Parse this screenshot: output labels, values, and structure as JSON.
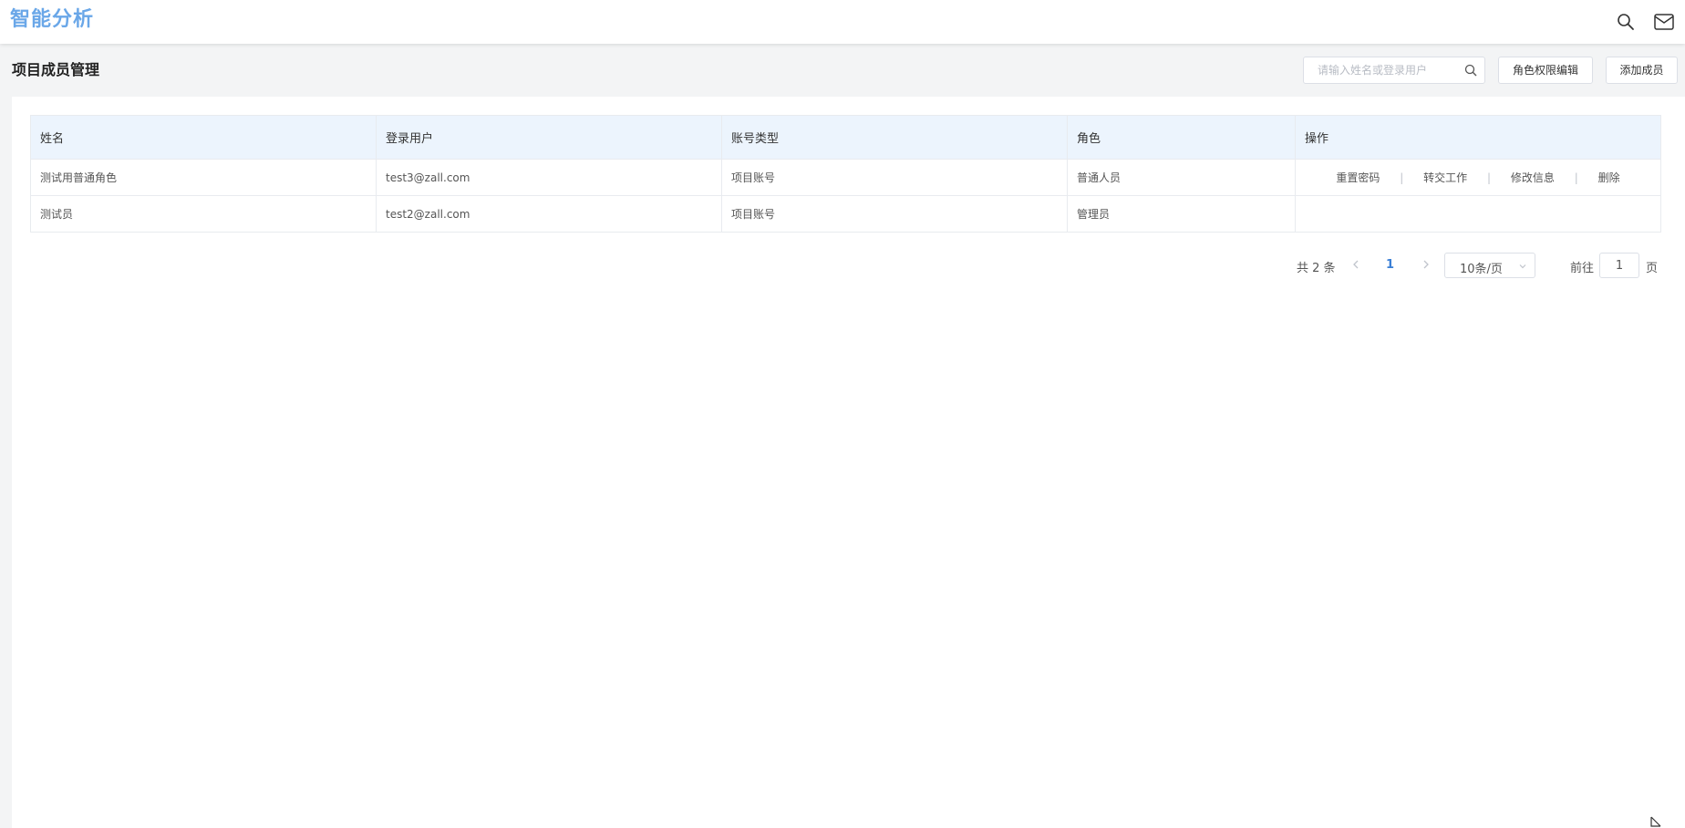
{
  "app": {
    "title": "智能分析"
  },
  "topbar": {
    "icons": [
      "search-icon",
      "mail-icon"
    ]
  },
  "page": {
    "title": "项目成员管理"
  },
  "toolbar": {
    "search_placeholder": "请输入姓名或登录用户",
    "roles_button": "角色权限编辑",
    "add_button": "添加成员"
  },
  "table": {
    "headers": [
      "姓名",
      "登录用户",
      "账号类型",
      "角色",
      "操作"
    ],
    "rows": [
      {
        "name": "测试用普通角色",
        "login": "test3@zall.com",
        "account_type": "项目账号",
        "role": "普通人员",
        "actions": [
          "重置密码",
          "转交工作",
          "修改信息",
          "删除"
        ]
      },
      {
        "name": "测试员",
        "login": "test2@zall.com",
        "account_type": "项目账号",
        "role": "管理员",
        "actions": []
      }
    ],
    "action_separator": "|"
  },
  "pagination": {
    "total_text": "共 2 条",
    "current_page": "1",
    "page_size": "10条/页",
    "goto_label": "前往",
    "goto_value": "1",
    "page_unit": "页"
  },
  "colors": {
    "accent": "#6aa7e8",
    "header_bg": "#ecf4fd",
    "page_active": "#3a7fd5"
  }
}
